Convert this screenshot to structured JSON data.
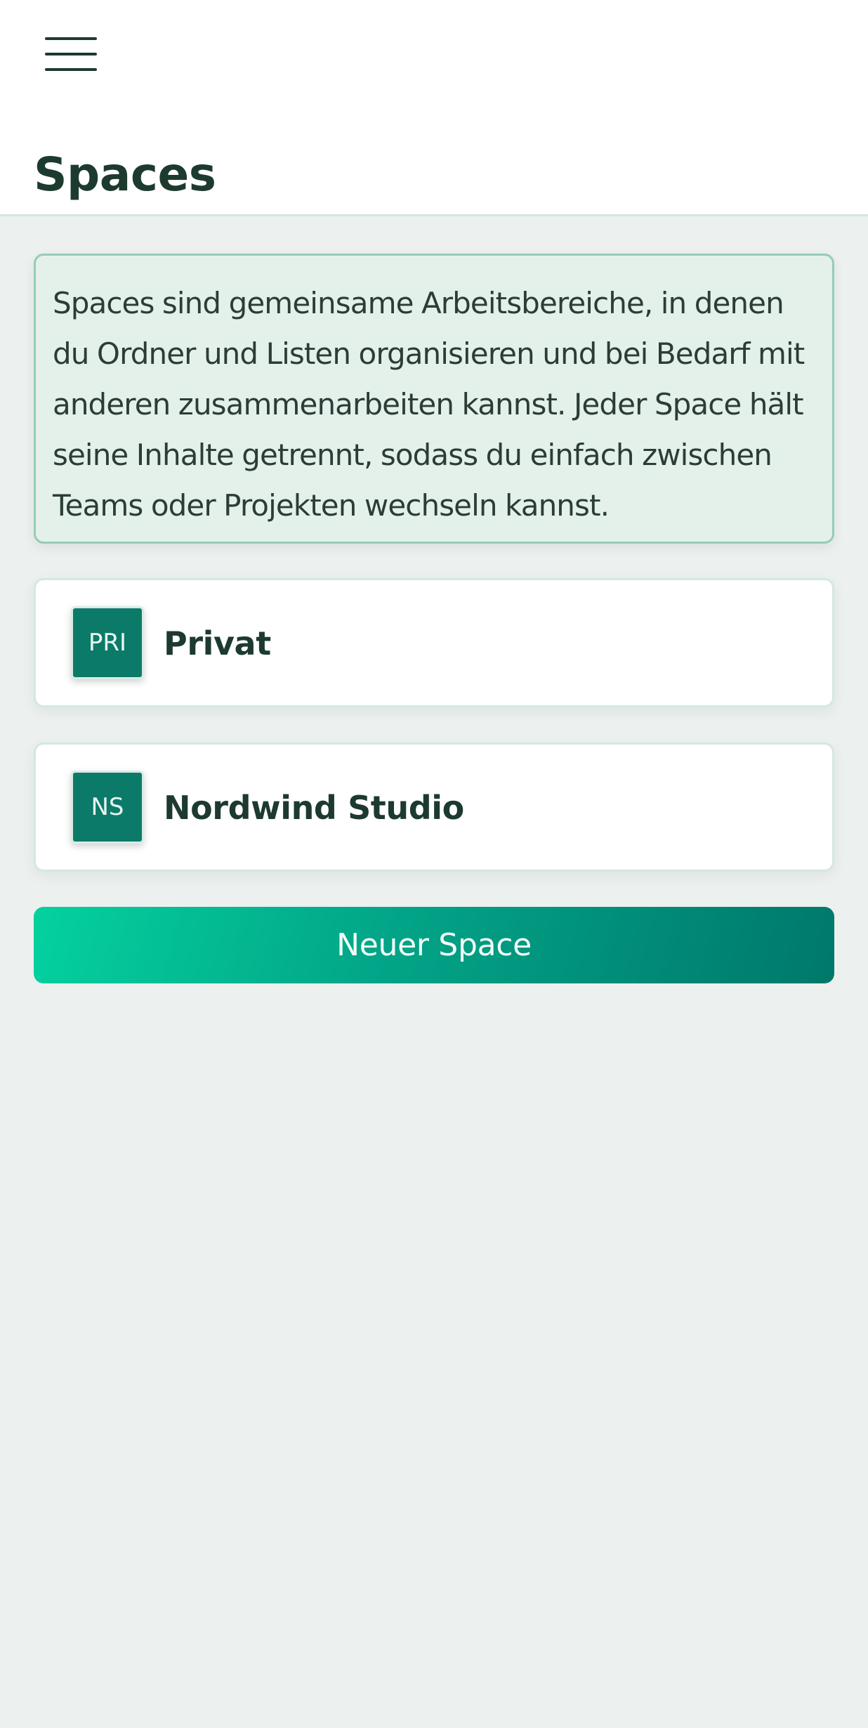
{
  "header": {
    "title": "Spaces",
    "menu_icon": "hamburger-menu-icon"
  },
  "info": {
    "text": "Spaces sind gemeinsame Arbeitsbereiche, in denen du Ordner und Listen organisieren und bei Bedarf mit anderen zusammenarbeiten kannst. Jeder Space hält seine Inhalte getrennt, sodass du einfach zwischen Teams oder Projekten wechseln kannst."
  },
  "spaces": [
    {
      "initials": "PRI",
      "name": "Privat"
    },
    {
      "initials": "NS",
      "name": "Nordwind Studio"
    }
  ],
  "actions": {
    "new_space_label": "Neuer Space"
  },
  "colors": {
    "background": "#ecf0ef",
    "text": "#1d3a2f",
    "avatar": "#0c7a68",
    "info_background": "#e3f1ea",
    "info_border": "#95ccb5",
    "button_gradient_start": "#04d19f",
    "button_gradient_end": "#00786a"
  }
}
